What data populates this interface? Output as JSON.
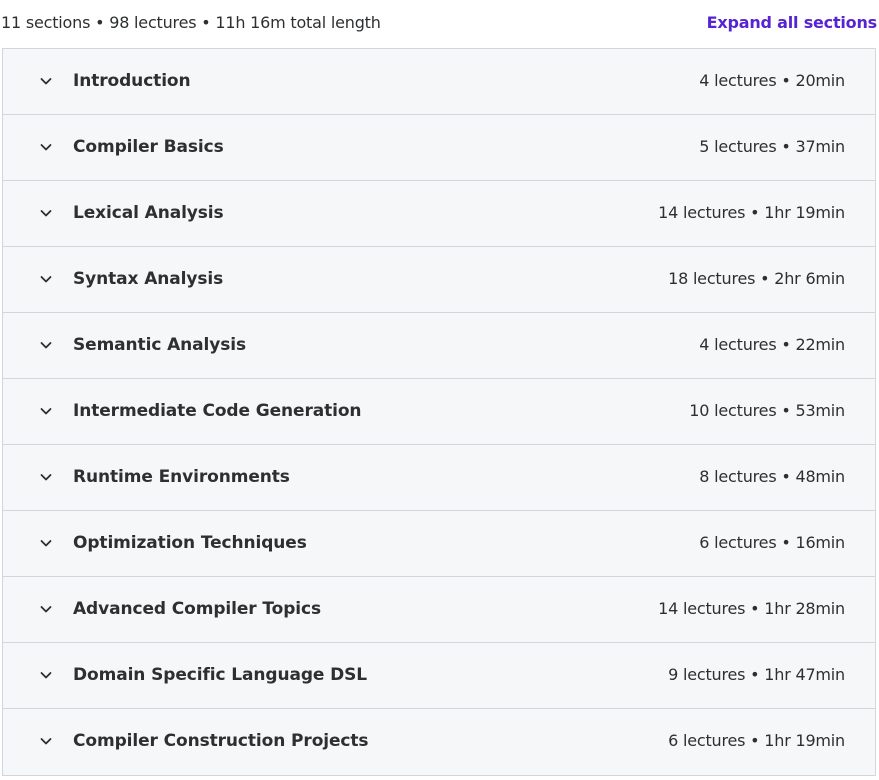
{
  "header": {
    "summary": "11 sections • 98 lectures • 11h 16m total length",
    "expand_all_label": "Expand all sections"
  },
  "colors": {
    "accent": "#5624d0",
    "row_background": "#f6f7f9",
    "border": "#d1d7dc",
    "text": "#2d2f31"
  },
  "icons": {
    "row_toggle": "chevron-down-icon"
  },
  "sections": [
    {
      "title": "Introduction",
      "meta": "4 lectures • 20min"
    },
    {
      "title": "Compiler Basics",
      "meta": "5 lectures • 37min"
    },
    {
      "title": "Lexical Analysis",
      "meta": "14 lectures • 1hr 19min"
    },
    {
      "title": "Syntax Analysis",
      "meta": "18 lectures • 2hr 6min"
    },
    {
      "title": "Semantic Analysis",
      "meta": "4 lectures • 22min"
    },
    {
      "title": "Intermediate Code Generation",
      "meta": "10 lectures • 53min"
    },
    {
      "title": "Runtime Environments",
      "meta": "8 lectures • 48min"
    },
    {
      "title": "Optimization Techniques",
      "meta": "6 lectures • 16min"
    },
    {
      "title": "Advanced Compiler Topics",
      "meta": "14 lectures • 1hr 28min"
    },
    {
      "title": "Domain Specific Language DSL",
      "meta": "9 lectures • 1hr 47min"
    },
    {
      "title": "Compiler Construction Projects",
      "meta": "6 lectures • 1hr 19min"
    }
  ]
}
